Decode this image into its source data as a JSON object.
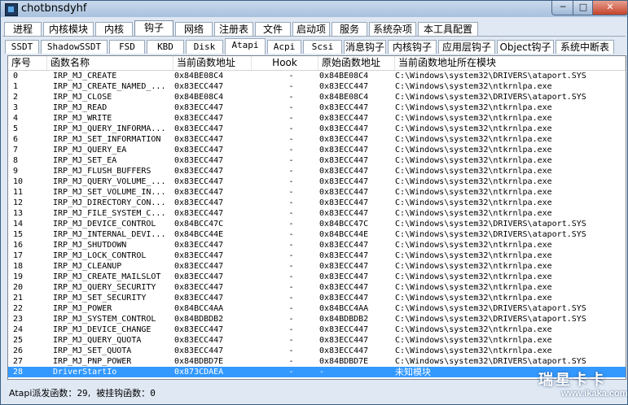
{
  "window": {
    "title": "chotbnsdyhf"
  },
  "title_buttons": {
    "minimize": "─",
    "maximize": "□",
    "close": "✕"
  },
  "main_tabs": [
    {
      "label": "进程"
    },
    {
      "label": "内核模块"
    },
    {
      "label": "内核"
    },
    {
      "label": "钩子"
    },
    {
      "label": "网络"
    },
    {
      "label": "注册表"
    },
    {
      "label": "文件"
    },
    {
      "label": "启动项"
    },
    {
      "label": "服务"
    },
    {
      "label": "系统杂项"
    },
    {
      "label": "本工具配置"
    }
  ],
  "active_main_tab": "钩子",
  "sub_tabs": [
    {
      "label": "SSDT"
    },
    {
      "label": "ShadowSSDT"
    },
    {
      "label": "FSD"
    },
    {
      "label": "KBD"
    },
    {
      "label": "Disk"
    },
    {
      "label": "Atapi"
    },
    {
      "label": "Acpi"
    },
    {
      "label": "Scsi"
    },
    {
      "label": "消息钩子"
    },
    {
      "label": "内核钩子"
    },
    {
      "label": "应用层钩子"
    },
    {
      "label": "Object钩子"
    },
    {
      "label": "系统中断表"
    }
  ],
  "active_sub_tab": "Atapi",
  "table": {
    "headers": [
      "序号",
      "函数名称",
      "当前函数地址",
      "Hook",
      "原始函数地址",
      "当前函数地址所在模块"
    ],
    "rows": [
      [
        "0",
        "IRP_MJ_CREATE",
        "0x84BE08C4",
        "-",
        "0x84BE08C4",
        "C:\\Windows\\system32\\DRIVERS\\ataport.SYS"
      ],
      [
        "1",
        "IRP_MJ_CREATE_NAMED_...",
        "0x83ECC447",
        "-",
        "0x83ECC447",
        "C:\\Windows\\system32\\ntkrnlpa.exe"
      ],
      [
        "2",
        "IRP_MJ_CLOSE",
        "0x84BE08C4",
        "-",
        "0x84BE08C4",
        "C:\\Windows\\system32\\DRIVERS\\ataport.SYS"
      ],
      [
        "3",
        "IRP_MJ_READ",
        "0x83ECC447",
        "-",
        "0x83ECC447",
        "C:\\Windows\\system32\\ntkrnlpa.exe"
      ],
      [
        "4",
        "IRP_MJ_WRITE",
        "0x83ECC447",
        "-",
        "0x83ECC447",
        "C:\\Windows\\system32\\ntkrnlpa.exe"
      ],
      [
        "5",
        "IRP_MJ_QUERY_INFORMA...",
        "0x83ECC447",
        "-",
        "0x83ECC447",
        "C:\\Windows\\system32\\ntkrnlpa.exe"
      ],
      [
        "6",
        "IRP_MJ_SET_INFORMATION",
        "0x83ECC447",
        "-",
        "0x83ECC447",
        "C:\\Windows\\system32\\ntkrnlpa.exe"
      ],
      [
        "7",
        "IRP_MJ_QUERY_EA",
        "0x83ECC447",
        "-",
        "0x83ECC447",
        "C:\\Windows\\system32\\ntkrnlpa.exe"
      ],
      [
        "8",
        "IRP_MJ_SET_EA",
        "0x83ECC447",
        "-",
        "0x83ECC447",
        "C:\\Windows\\system32\\ntkrnlpa.exe"
      ],
      [
        "9",
        "IRP_MJ_FLUSH_BUFFERS",
        "0x83ECC447",
        "-",
        "0x83ECC447",
        "C:\\Windows\\system32\\ntkrnlpa.exe"
      ],
      [
        "10",
        "IRP_MJ_QUERY_VOLUME_...",
        "0x83ECC447",
        "-",
        "0x83ECC447",
        "C:\\Windows\\system32\\ntkrnlpa.exe"
      ],
      [
        "11",
        "IRP_MJ_SET_VOLUME_IN...",
        "0x83ECC447",
        "-",
        "0x83ECC447",
        "C:\\Windows\\system32\\ntkrnlpa.exe"
      ],
      [
        "12",
        "IRP_MJ_DIRECTORY_CON...",
        "0x83ECC447",
        "-",
        "0x83ECC447",
        "C:\\Windows\\system32\\ntkrnlpa.exe"
      ],
      [
        "13",
        "IRP_MJ_FILE_SYSTEM_C...",
        "0x83ECC447",
        "-",
        "0x83ECC447",
        "C:\\Windows\\system32\\ntkrnlpa.exe"
      ],
      [
        "14",
        "IRP_MJ_DEVICE_CONTROL",
        "0x84BCC47C",
        "-",
        "0x84BCC47C",
        "C:\\Windows\\system32\\DRIVERS\\ataport.SYS"
      ],
      [
        "15",
        "IRP_MJ_INTERNAL_DEVI...",
        "0x84BCC44E",
        "-",
        "0x84BCC44E",
        "C:\\Windows\\system32\\DRIVERS\\ataport.SYS"
      ],
      [
        "16",
        "IRP_MJ_SHUTDOWN",
        "0x83ECC447",
        "-",
        "0x83ECC447",
        "C:\\Windows\\system32\\ntkrnlpa.exe"
      ],
      [
        "17",
        "IRP_MJ_LOCK_CONTROL",
        "0x83ECC447",
        "-",
        "0x83ECC447",
        "C:\\Windows\\system32\\ntkrnlpa.exe"
      ],
      [
        "18",
        "IRP_MJ_CLEANUP",
        "0x83ECC447",
        "-",
        "0x83ECC447",
        "C:\\Windows\\system32\\ntkrnlpa.exe"
      ],
      [
        "19",
        "IRP_MJ_CREATE_MAILSLOT",
        "0x83ECC447",
        "-",
        "0x83ECC447",
        "C:\\Windows\\system32\\ntkrnlpa.exe"
      ],
      [
        "20",
        "IRP_MJ_QUERY_SECURITY",
        "0x83ECC447",
        "-",
        "0x83ECC447",
        "C:\\Windows\\system32\\ntkrnlpa.exe"
      ],
      [
        "21",
        "IRP_MJ_SET_SECURITY",
        "0x83ECC447",
        "-",
        "0x83ECC447",
        "C:\\Windows\\system32\\ntkrnlpa.exe"
      ],
      [
        "22",
        "IRP_MJ_POWER",
        "0x84BCC4AA",
        "-",
        "0x84BCC4AA",
        "C:\\Windows\\system32\\DRIVERS\\ataport.SYS"
      ],
      [
        "23",
        "IRP_MJ_SYSTEM_CONTROL",
        "0x84BDBDB2",
        "-",
        "0x84BDBDB2",
        "C:\\Windows\\system32\\DRIVERS\\ataport.SYS"
      ],
      [
        "24",
        "IRP_MJ_DEVICE_CHANGE",
        "0x83ECC447",
        "-",
        "0x83ECC447",
        "C:\\Windows\\system32\\ntkrnlpa.exe"
      ],
      [
        "25",
        "IRP_MJ_QUERY_QUOTA",
        "0x83ECC447",
        "-",
        "0x83ECC447",
        "C:\\Windows\\system32\\ntkrnlpa.exe"
      ],
      [
        "26",
        "IRP_MJ_SET_QUOTA",
        "0x83ECC447",
        "-",
        "0x83ECC447",
        "C:\\Windows\\system32\\ntkrnlpa.exe"
      ],
      [
        "27",
        "IRP_MJ_PNP_POWER",
        "0x84BDBD7E",
        "-",
        "0x84BDBD7E",
        "C:\\Windows\\system32\\DRIVERS\\ataport.SYS"
      ],
      [
        "28",
        "DriverStartIo",
        "0x873CDAEA",
        "-",
        "-",
        "未知模块"
      ]
    ],
    "selected_row": 28
  },
  "status": {
    "dispatch_label": "Atapi派发函数：",
    "dispatch_count": "29",
    "hooked_label": "被挂钩函数：",
    "hooked_count": "0"
  },
  "watermark": {
    "main": "瑞星卡卡",
    "url": "www.ikaka.com"
  }
}
